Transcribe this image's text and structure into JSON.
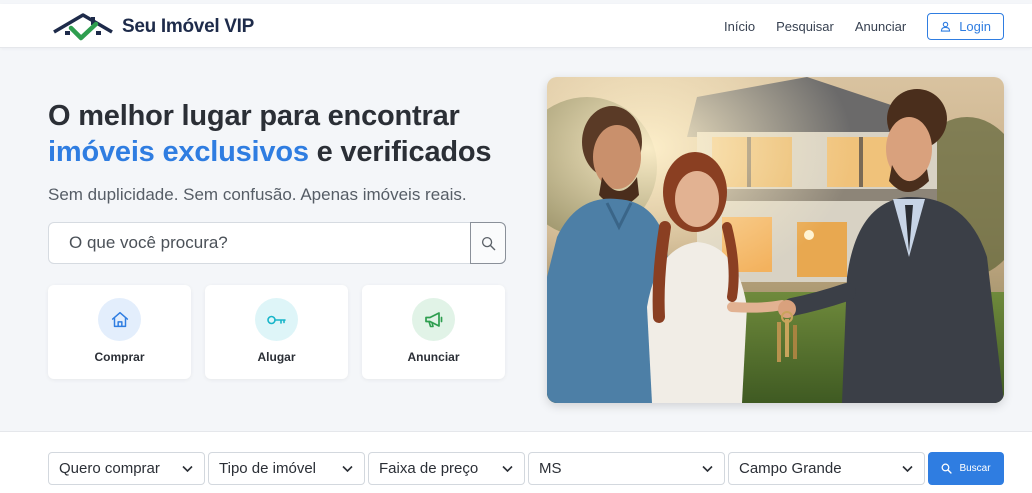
{
  "brand": {
    "name": "Seu Imóvel VIP",
    "logo_colors": {
      "roof": "#1e2b4a",
      "check": "#2e9e4f"
    }
  },
  "nav": {
    "items": [
      "Início",
      "Pesquisar",
      "Anunciar"
    ],
    "login_label": "Login"
  },
  "hero": {
    "headline_part1": "O melhor lugar para encontrar",
    "headline_accent": "imóveis exclusivos",
    "headline_part2": " e verificados",
    "subheadline": "Sem duplicidade. Sem confusão. Apenas imóveis reais.",
    "search_placeholder": "O que você procura?"
  },
  "actions": [
    {
      "label": "Comprar",
      "icon": "house-icon",
      "color": "#2f7de1"
    },
    {
      "label": "Alugar",
      "icon": "key-icon",
      "color": "#18b5c9"
    },
    {
      "label": "Anunciar",
      "icon": "megaphone-icon",
      "color": "#2e9e4f"
    }
  ],
  "filters": {
    "intent": "Quero comprar",
    "type": "Tipo de imóvel",
    "price": "Faixa de preço",
    "state": "MS",
    "city": "Campo Grande",
    "submit_label": "Buscar"
  },
  "colors": {
    "accent": "#2f7de1",
    "headline": "#2b2f36"
  }
}
